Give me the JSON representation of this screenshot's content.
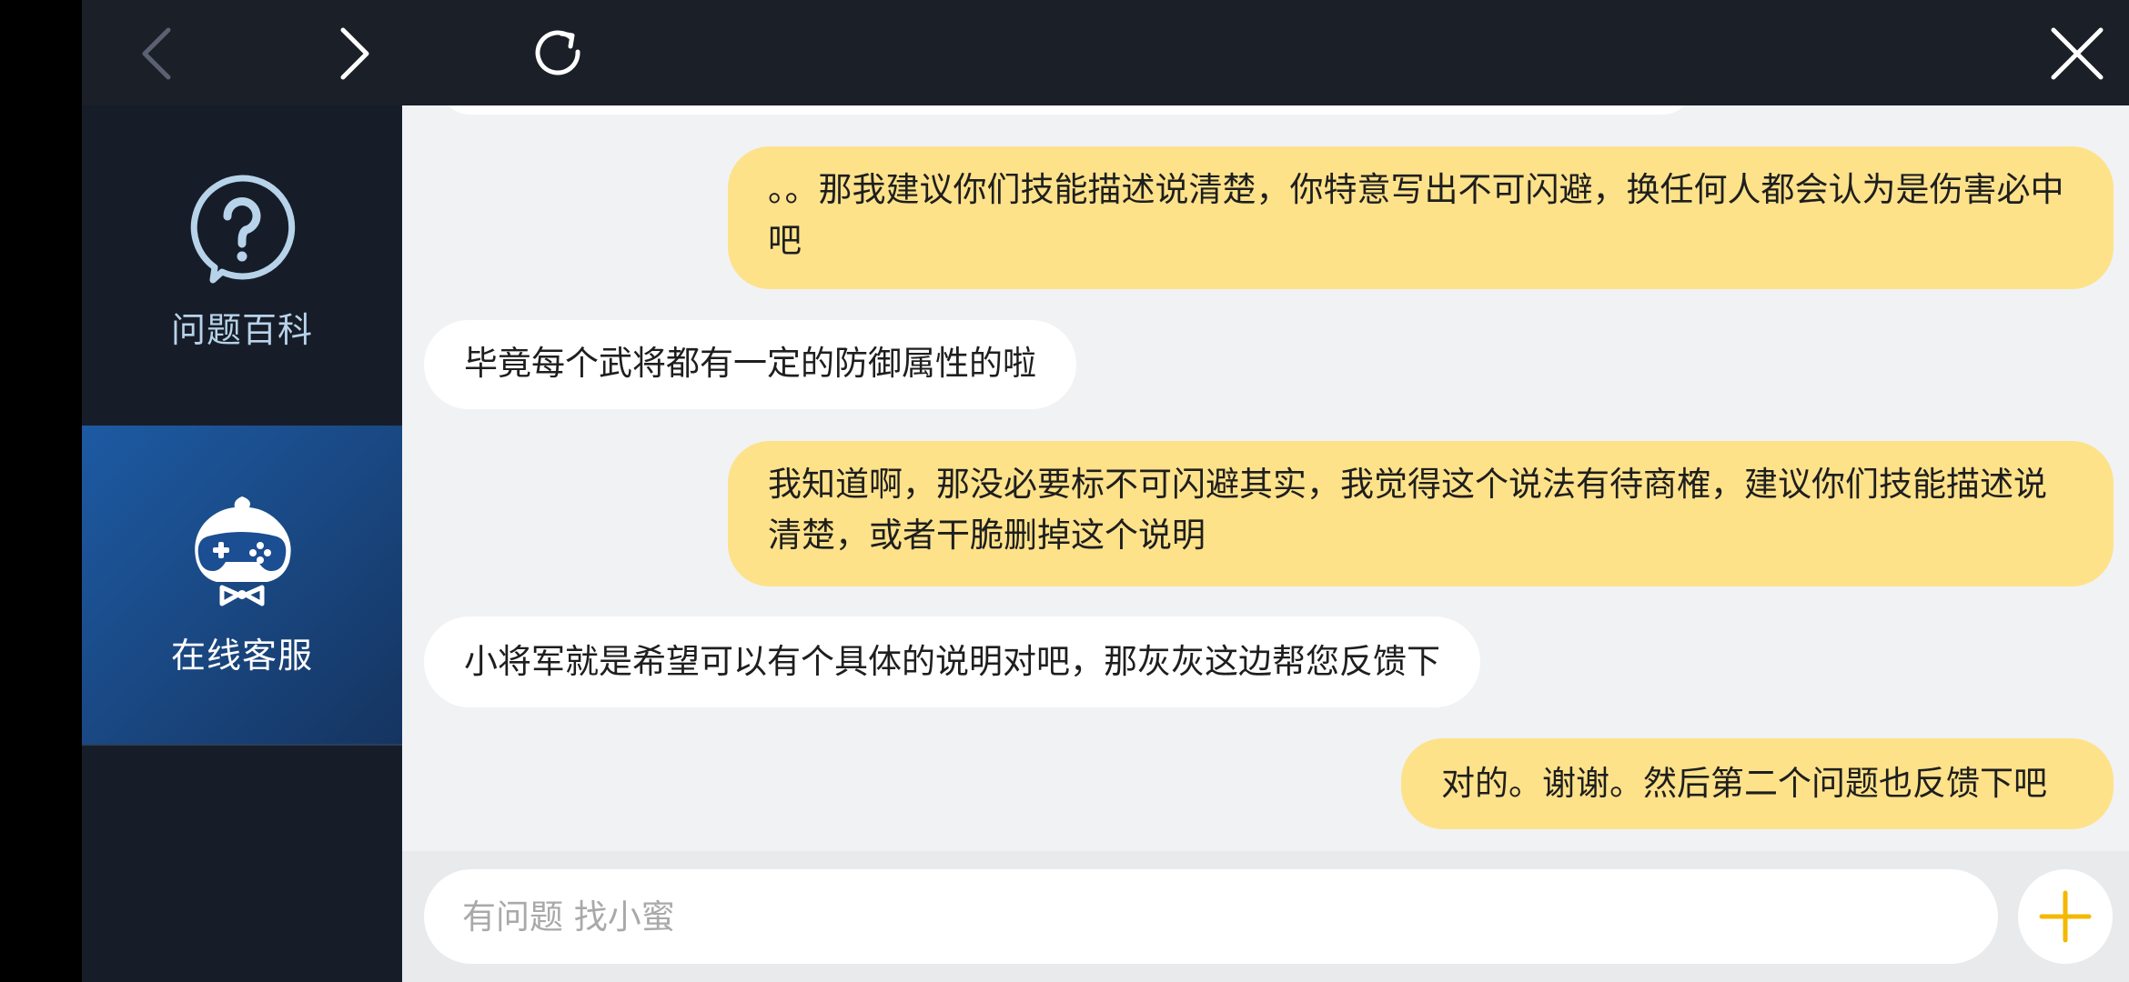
{
  "toolbar": {
    "back_icon": "chevron-left-icon",
    "forward_icon": "chevron-right-icon",
    "refresh_icon": "refresh-icon",
    "close_icon": "close-icon"
  },
  "sidebar": {
    "items": [
      {
        "label": "问题百科",
        "icon": "question-icon",
        "active": false
      },
      {
        "label": "在线客服",
        "icon": "gamepad-mascot-icon",
        "active": true
      }
    ]
  },
  "messages": [
    {
      "from": "user",
      "text": "。。那我建议你们技能描述说清楚，你特意写出不可闪避，换任何人都会认为是伤害必中吧"
    },
    {
      "from": "agent",
      "text": "毕竟每个武将都有一定的防御属性的啦"
    },
    {
      "from": "user",
      "text": "我知道啊，那没必要标不可闪避其实，我觉得这个说法有待商榷，建议你们技能描述说清楚，或者干脆删掉这个说明"
    },
    {
      "from": "agent",
      "text": "小将军就是希望可以有个具体的说明对吧，那灰灰这边帮您反馈下"
    },
    {
      "from": "user",
      "text": "对的。谢谢。然后第二个问题也反馈下吧"
    }
  ],
  "input": {
    "placeholder": "有问题 找小蜜",
    "value": ""
  },
  "colors": {
    "topbar": "#1a1f28",
    "sidebar": "#171d28",
    "active_item": "#1d5aa3",
    "user_bubble": "#fde28a",
    "agent_bubble": "#ffffff",
    "chat_bg": "#f1f2f4",
    "plus_accent": "#f5b800"
  }
}
